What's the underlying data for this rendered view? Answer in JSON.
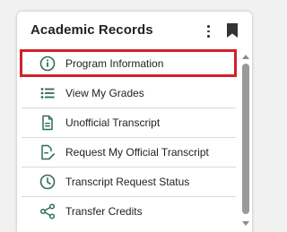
{
  "widget": {
    "title": "Academic Records",
    "accent_color": "#2f6e55",
    "highlight_color": "#d3202a",
    "items": [
      {
        "label": "Program Information",
        "icon": "info-icon"
      },
      {
        "label": "View My Grades",
        "icon": "list-icon"
      },
      {
        "label": "Unofficial Transcript",
        "icon": "document-icon"
      },
      {
        "label": "Request My Official Transcript",
        "icon": "document-edit-icon"
      },
      {
        "label": "Transcript Request Status",
        "icon": "clock-icon"
      },
      {
        "label": "Transfer Credits",
        "icon": "share-icon"
      }
    ]
  }
}
